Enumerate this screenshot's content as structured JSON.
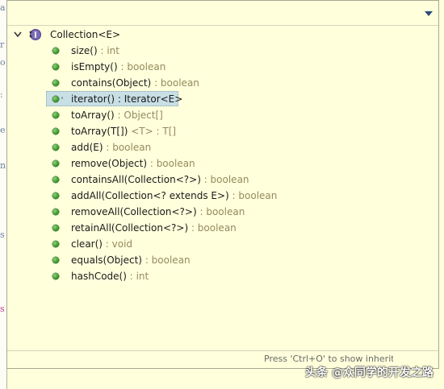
{
  "popup": {
    "status_hint": "Press 'Ctrl+O' to show inherited members"
  },
  "tree": {
    "root": {
      "name": "Collection<E>",
      "icon": "interface-icon",
      "expanded": true
    },
    "members": [
      {
        "name": "size()",
        "type": " : int",
        "selected": false
      },
      {
        "name": "isEmpty()",
        "type": " : boolean",
        "selected": false
      },
      {
        "name": "contains(Object)",
        "type": " : boolean",
        "selected": false
      },
      {
        "name": "iterator()",
        "type": " : Iterator<E>",
        "selected": true
      },
      {
        "name": "toArray()",
        "type": " : Object[]",
        "selected": false
      },
      {
        "name": "toArray(T[])",
        "type": " <T> : T[]",
        "selected": false
      },
      {
        "name": "add(E)",
        "type": " : boolean",
        "selected": false
      },
      {
        "name": "remove(Object)",
        "type": " : boolean",
        "selected": false
      },
      {
        "name": "containsAll(Collection<?>)",
        "type": " : boolean",
        "selected": false
      },
      {
        "name": "addAll(Collection<? extends E>)",
        "type": " : boolean",
        "selected": false
      },
      {
        "name": "removeAll(Collection<?>)",
        "type": " : boolean",
        "selected": false
      },
      {
        "name": "retainAll(Collection<?>)",
        "type": " : boolean",
        "selected": false
      },
      {
        "name": "clear()",
        "type": " : void",
        "selected": false
      },
      {
        "name": "equals(Object)",
        "type": " : boolean",
        "selected": false
      },
      {
        "name": "hashCode()",
        "type": " : int",
        "selected": false
      }
    ]
  },
  "watermark": "头条 @众同学的开发之路",
  "colors": {
    "background": "#ffffdc",
    "selection": "#c8dfe5",
    "method_dot": "#2f8a22",
    "type_text": "#958a5e"
  }
}
